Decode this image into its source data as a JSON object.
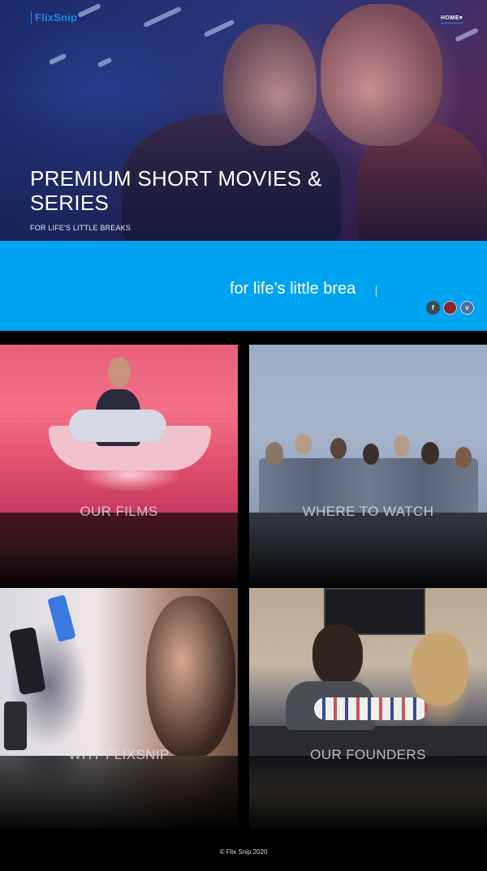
{
  "header": {
    "logo": "FlixSnip",
    "nav_home": "HOME"
  },
  "hero": {
    "title": "PREMIUM SHORT MOVIES & SERIES",
    "subtitle": "FOR LIFE'S LITTLE BREAKS"
  },
  "banner": {
    "typing_text": "for life’s little brea",
    "social": [
      {
        "name": "facebook-icon",
        "glyph": "f"
      },
      {
        "name": "instagram-icon",
        "glyph": ""
      },
      {
        "name": "vimeo-icon",
        "glyph": "v"
      }
    ]
  },
  "tiles": [
    {
      "label": "OUR FILMS"
    },
    {
      "label": "WHERE TO WATCH"
    },
    {
      "label": "WHY FLIXSNIP"
    },
    {
      "label": "OUR FOUNDERS"
    }
  ],
  "footer": {
    "copyright": "© Flix Snip 2020"
  },
  "colors": {
    "accent_blue": "#00a3ef",
    "logo_blue": "#1e88e5",
    "background": "#000000"
  }
}
